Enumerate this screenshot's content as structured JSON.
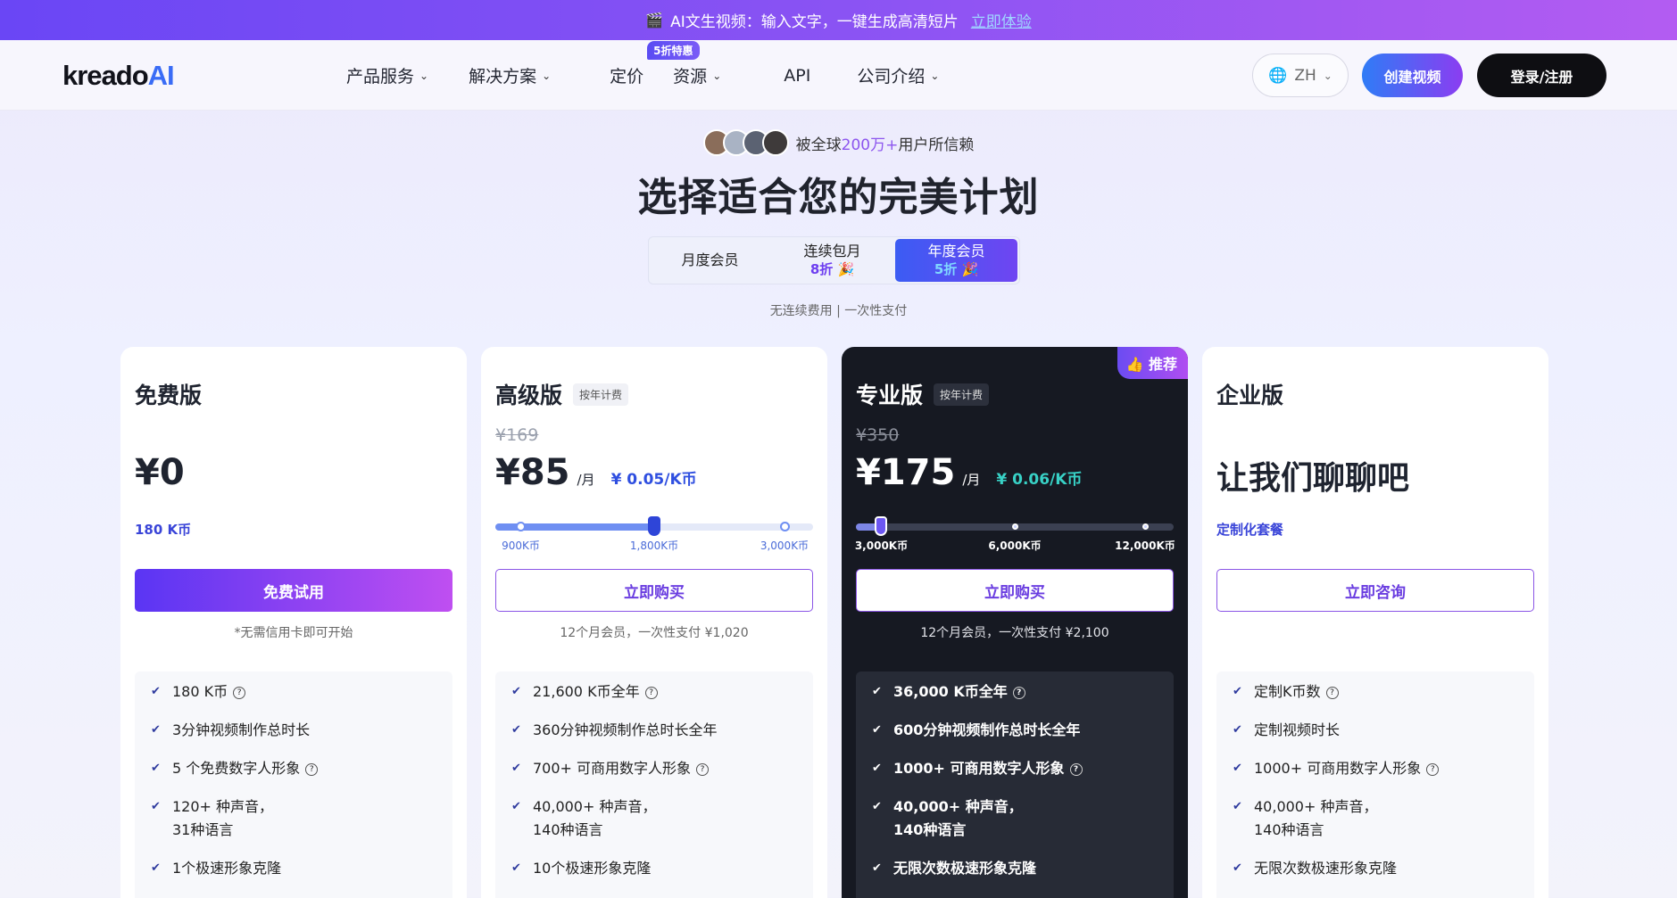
{
  "promo": {
    "icon": "clapperboard-icon",
    "text": "AI文生视频：输入文字，一键生成高清短片",
    "link": "立即体验"
  },
  "header": {
    "logo_main": "kreado",
    "logo_ai": "AI",
    "nav": [
      {
        "label": "产品服务",
        "has_menu": true
      },
      {
        "label": "解决方案",
        "has_menu": true
      },
      {
        "label": "定价",
        "has_menu": false,
        "badge": "5折特惠"
      },
      {
        "label": "资源",
        "has_menu": true
      },
      {
        "label": "API",
        "has_menu": false
      },
      {
        "label": "公司介绍",
        "has_menu": true
      }
    ],
    "lang": "ZH",
    "create_btn": "创建视频",
    "login_btn": "登录/注册"
  },
  "hero": {
    "trust_prefix": "被全球",
    "trust_highlight": "200万+",
    "trust_suffix": "用户所信赖",
    "title": "选择适合您的完美计划",
    "toggle": [
      {
        "label": "月度会员",
        "discount": ""
      },
      {
        "label": "连续包月",
        "discount": "8折 🎉"
      },
      {
        "label": "年度会员",
        "discount": "5折 🎉"
      }
    ],
    "note": "无连续费用 | 一次性支付"
  },
  "plans": [
    {
      "name": "免费版",
      "tag": "",
      "original": "",
      "price": "¥0",
      "per": "",
      "unit_price": "",
      "sub_link": "180 K币",
      "cta": "免费试用",
      "pay_note": "*无需信用卡即可开始",
      "features": [
        {
          "text": "180 K币",
          "help": true
        },
        {
          "text": "3分钟视频制作总时长",
          "help": false
        },
        {
          "text": "5 个免费数字人形象",
          "help": true
        },
        {
          "text": "120+ 种声音，\n31种语言",
          "help": false
        },
        {
          "text": "1个极速形象克隆",
          "help": false
        }
      ]
    },
    {
      "name": "高级版",
      "tag": "按年计费",
      "original": "¥169",
      "price": "¥85",
      "per": "/月",
      "unit_price": "¥ 0.05/K币",
      "slider": {
        "ticks": [
          "900K币",
          "1,800K币",
          "3,000K币"
        ],
        "selected": 1
      },
      "cta": "立即购买",
      "pay_note": "12个月会员，一次性支付 ¥1,020",
      "features": [
        {
          "text": "21,600 K币全年",
          "help": true
        },
        {
          "text": "360分钟视频制作总时长全年",
          "help": false
        },
        {
          "text": "700+ 可商用数字人形象",
          "help": true
        },
        {
          "text": "40,000+ 种声音，\n140种语言",
          "help": false
        },
        {
          "text": "10个极速形象克隆",
          "help": false
        }
      ]
    },
    {
      "name": "专业版",
      "tag": "按年计费",
      "badge": "👍 推荐",
      "original": "¥350",
      "price": "¥175",
      "per": "/月",
      "unit_price": "¥ 0.06/K币",
      "slider": {
        "ticks": [
          "3,000K币",
          "6,000K币",
          "12,000K币"
        ],
        "selected": 0
      },
      "cta": "立即购买",
      "pay_note": "12个月会员，一次性支付 ¥2,100",
      "features": [
        {
          "text": "36,000 K币全年",
          "help": true
        },
        {
          "text": "600分钟视频制作总时长全年",
          "help": false
        },
        {
          "text": "1000+ 可商用数字人形象",
          "help": true
        },
        {
          "text": "40,000+ 种声音，\n140种语言",
          "help": false
        },
        {
          "text": "无限次数极速形象克隆",
          "help": false
        }
      ]
    },
    {
      "name": "企业版",
      "tag": "",
      "original": "",
      "price_text": "让我们聊聊吧",
      "sub_link": "定制化套餐",
      "cta": "立即咨询",
      "pay_note": "",
      "features": [
        {
          "text": "定制K币数",
          "help": true
        },
        {
          "text": "定制视频时长",
          "help": false
        },
        {
          "text": "1000+ 可商用数字人形象",
          "help": true
        },
        {
          "text": "40,000+ 种声音，\n140种语言",
          "help": false
        },
        {
          "text": "无限次数极速形象克隆",
          "help": false
        }
      ]
    }
  ],
  "colors": {
    "accent": "#6a46f5",
    "brand_blue": "#2f4fe0",
    "dark_card": "#161922",
    "teal": "#38d1c6"
  }
}
